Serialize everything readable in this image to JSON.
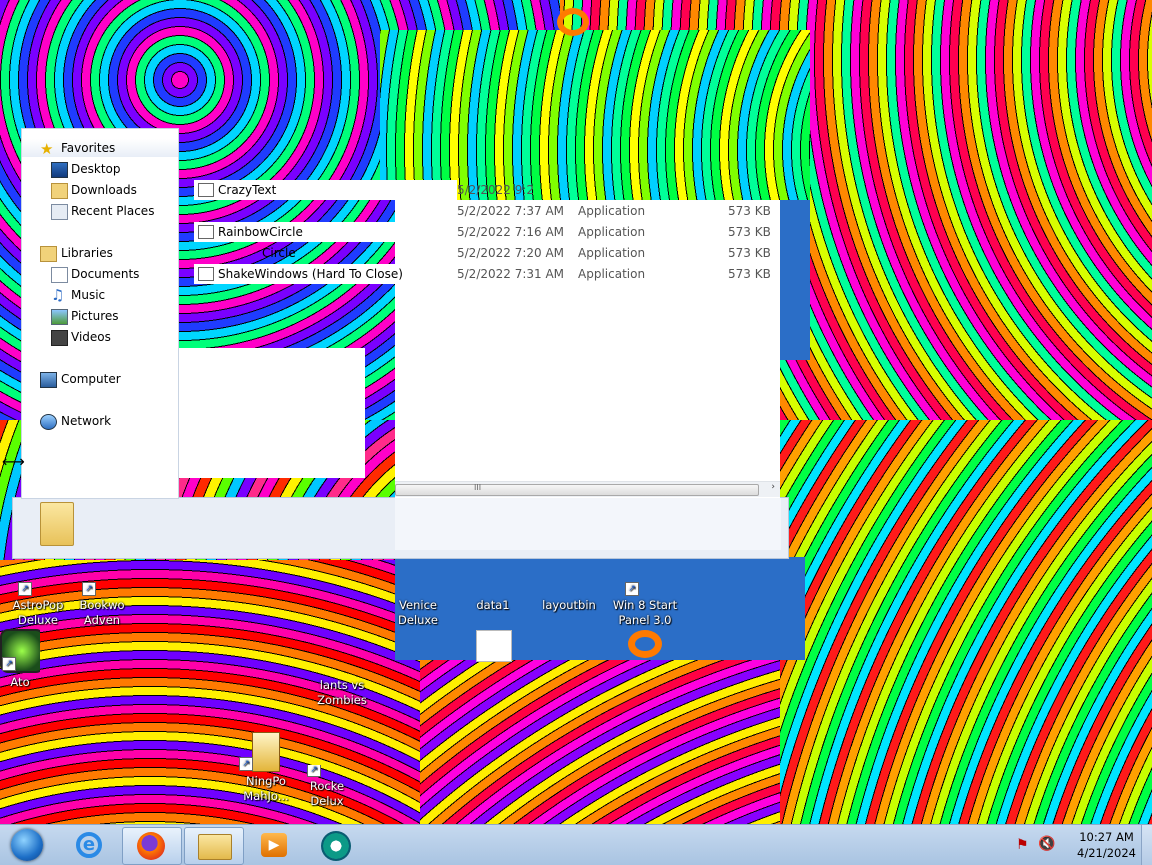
{
  "navigation_pane": {
    "favorites": {
      "label": "Favorites",
      "items": [
        "Desktop",
        "Downloads",
        "Recent Places"
      ]
    },
    "libraries": {
      "label": "Libraries",
      "items": [
        "Documents",
        "Music",
        "Pictures",
        "Videos"
      ]
    },
    "computer": "Computer",
    "network": "Network"
  },
  "files": [
    {
      "name": "CrazyText",
      "date": "5/2/2022 9:2",
      "type": "",
      "size": ""
    },
    {
      "name": "",
      "date": "5/2/2022 7:37 AM",
      "type": "Application",
      "size": "573 KB"
    },
    {
      "name": "RainbowCircle",
      "date": "5/2/2022 7:16 AM",
      "type": "Application",
      "size": "573 KB"
    },
    {
      "name": "Circle",
      "date": "5/2/2022 7:20 AM",
      "type": "Application",
      "size": "573 KB"
    },
    {
      "name": "ShakeWindows (Hard To Close)",
      "date": "5/2/2022 7:31 AM",
      "type": "Application",
      "size": "573 KB"
    }
  ],
  "scrollbar": {
    "grip": "III",
    "right_arrow": "›"
  },
  "desktop_icons": [
    {
      "label": "AstroPop Deluxe",
      "icon": "astropop-icon"
    },
    {
      "label": "Bookwo Adven",
      "icon": "bookworm-icon"
    },
    {
      "label": "Venice Deluxe",
      "icon": "venice-icon"
    },
    {
      "label": "data1",
      "icon": "file-icon"
    },
    {
      "label": "layoutbin",
      "icon": "file-icon"
    },
    {
      "label": "Win 8 Start Panel 3.0",
      "icon": "win8-start-icon"
    },
    {
      "label": "Ato",
      "icon": "radiation-icon"
    },
    {
      "label": "lants vs Zombies",
      "icon": "plants-vs-zombies-icon"
    },
    {
      "label": "NingPo MahJo...",
      "icon": "mahjong-icon"
    },
    {
      "label": "Rocke Delux",
      "icon": "rocket-icon"
    }
  ],
  "taskbar": {
    "pinned": [
      "start-orb-icon",
      "internet-explorer-icon",
      "firefox-icon",
      "file-explorer-icon",
      "media-player-icon",
      "cursor-app-icon"
    ],
    "clock_time": "10:27 AM",
    "clock_date": "4/21/2024"
  },
  "colors": {
    "taskbar": "#b7cde8",
    "selection_accent": "#1f5fd0"
  }
}
